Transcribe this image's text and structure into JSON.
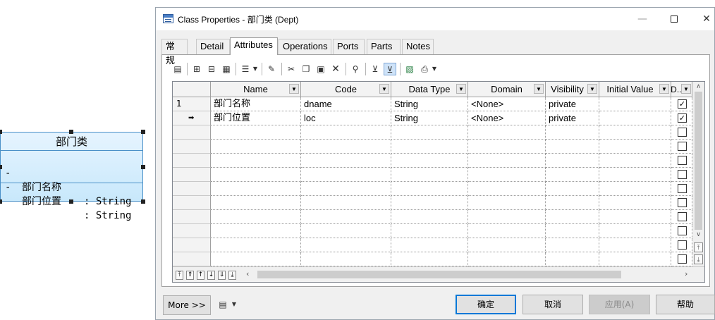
{
  "uml_class": {
    "name": "部门类",
    "attributes": [
      {
        "visibility": "-",
        "name": "部门名称",
        "type": ": String"
      },
      {
        "visibility": "-",
        "name": "部门位置",
        "type": ": String"
      }
    ]
  },
  "dialog": {
    "title": "Class Properties - 部门类 (Dept)",
    "window_controls": {
      "minimize": "—",
      "close": "✕"
    },
    "tabs": [
      "常规",
      "Detail",
      "Attributes",
      "Operations",
      "Ports",
      "Parts",
      "Notes"
    ],
    "active_tab": "Attributes",
    "toolbar_icons": [
      "properties-icon",
      "add-row-icon",
      "insert-row-icon",
      "add-attributes-icon",
      "customize-columns-icon",
      "find-icon",
      "cut-icon",
      "copy-icon",
      "paste-icon",
      "delete-icon",
      "search-icon",
      "filter-icon",
      "toggle-filter-icon",
      "excel-export-icon",
      "print-icon"
    ],
    "grid": {
      "columns": [
        "Name",
        "Code",
        "Data Type",
        "Domain",
        "Visibility",
        "Initial Value",
        "D..."
      ],
      "rows": [
        {
          "marker": "1",
          "name": "部门名称",
          "code": "dname",
          "data_type": "String",
          "domain": "<None>",
          "visibility": "private",
          "initial_value": "",
          "checked": true
        },
        {
          "marker": "➡",
          "name": "部门位置",
          "code": "loc",
          "data_type": "String",
          "domain": "<None>",
          "visibility": "private",
          "initial_value": "",
          "checked": true
        }
      ],
      "empty_rows": 10
    },
    "buttons": {
      "more": "More >>",
      "ok": "确定",
      "cancel": "取消",
      "apply": "应用(A)",
      "help": "帮助"
    }
  }
}
